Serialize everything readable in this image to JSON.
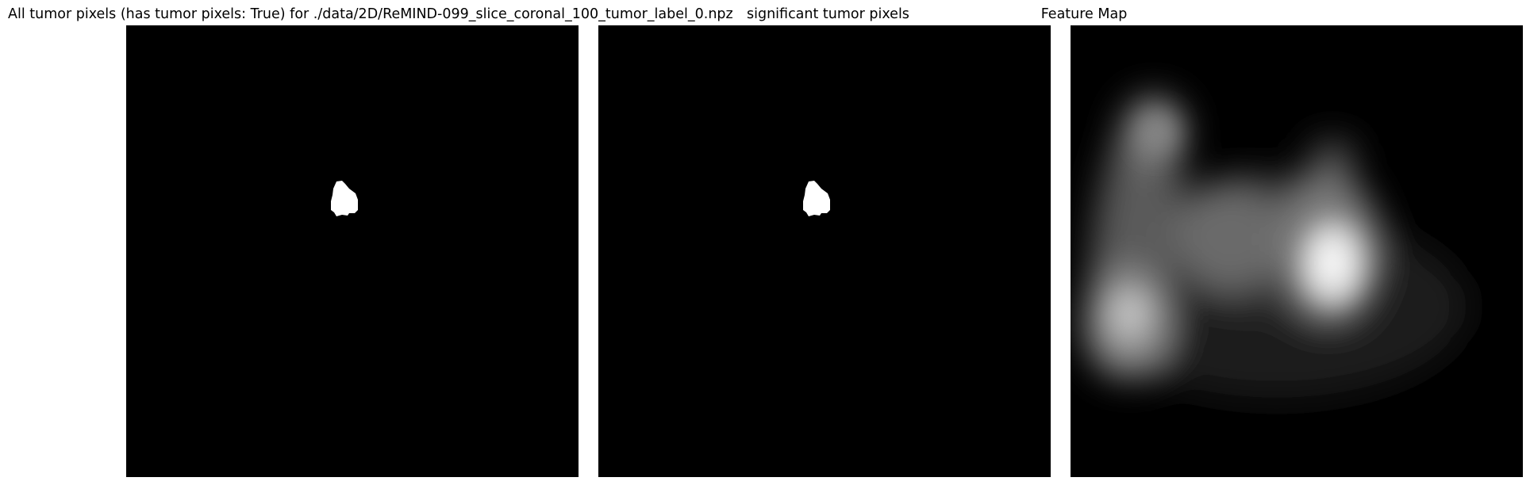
{
  "panels": [
    {
      "title": "All tumor pixels (has tumor pixels: True) for ./data/2D/ReMIND-099_slice_coronal_100_tumor_label_0.npz",
      "content": "binary-tumor-mask"
    },
    {
      "title": "significant tumor pixels",
      "content": "binary-tumor-mask"
    },
    {
      "title": "Feature Map",
      "content": "grayscale-feature-heatmap"
    }
  ],
  "colors": {
    "background": "#ffffff",
    "image_background": "#000000",
    "mask": "#ffffff"
  }
}
